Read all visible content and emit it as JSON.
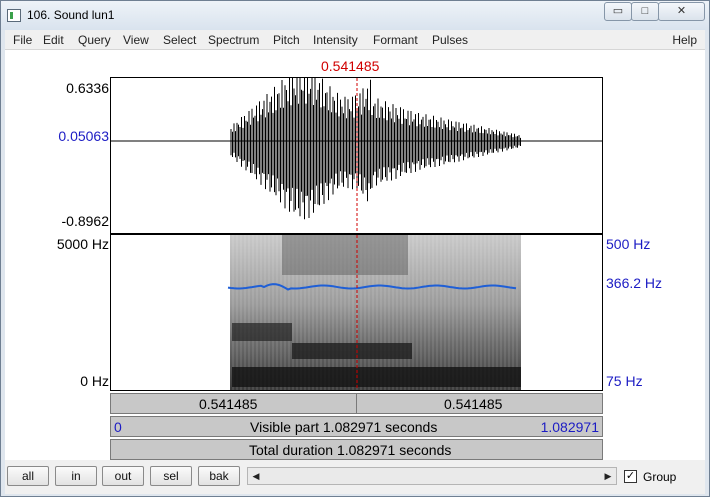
{
  "window": {
    "title": "106. Sound lun1",
    "minimize_glyph": "▭",
    "maximize_glyph": "□",
    "close_glyph": "✕"
  },
  "menu": {
    "items": [
      "File",
      "Edit",
      "Query",
      "View",
      "Select",
      "Spectrum",
      "Pitch",
      "Intensity",
      "Formant",
      "Pulses"
    ],
    "help": "Help"
  },
  "editor": {
    "cursor_time": "0.541485",
    "waveform": {
      "max": "0.6336",
      "cursor_value": "0.05063",
      "min": "-0.8962"
    },
    "spectrogram": {
      "top": "5000 Hz",
      "bottom": "0 Hz"
    },
    "pitch": {
      "top": "500 Hz",
      "value": "366.2 Hz",
      "bottom": "75 Hz"
    },
    "selection_bar": {
      "left_text": "0.541485",
      "right_text": "0.541485"
    },
    "visible_bar": {
      "start": "0",
      "text": "Visible part 1.082971 seconds",
      "end": "1.082971"
    },
    "total_bar": {
      "text": "Total duration 1.082971 seconds"
    },
    "colors": {
      "cursor": "#d00000",
      "pitch_curve": "#1f5fd6",
      "axis_blue": "#1c1cc4"
    }
  },
  "toolbar": {
    "all": "all",
    "in": "in",
    "out": "out",
    "sel": "sel",
    "bak": "bak",
    "scroll_left_glyph": "◀",
    "scroll_right_glyph": "▶",
    "group_checked_glyph": "✓",
    "group_label": "Group"
  }
}
